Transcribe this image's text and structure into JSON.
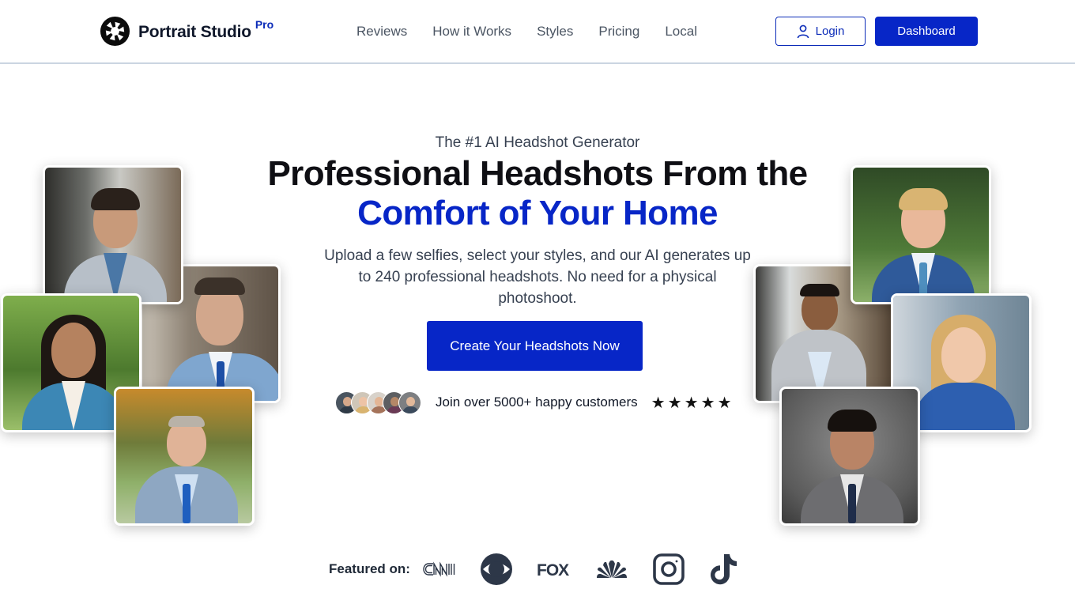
{
  "header": {
    "brand": "Portrait Studio",
    "brand_badge": "Pro",
    "nav": [
      {
        "label": "Reviews"
      },
      {
        "label": "How it Works"
      },
      {
        "label": "Styles"
      },
      {
        "label": "Pricing"
      },
      {
        "label": "Local"
      }
    ],
    "login_label": "Login",
    "dashboard_label": "Dashboard"
  },
  "hero": {
    "eyebrow": "The #1 AI Headshot Generator",
    "headline_line1": "Professional Headshots From the",
    "headline_line2": "Comfort of Your Home",
    "subtext": "Upload a few selfies, select your styles, and our AI generates up to 240 professional headshots. No need for a physical photoshoot.",
    "cta_label": "Create Your Headshots Now",
    "social_proof": "Join over 5000+ happy customers",
    "rating_stars": 5,
    "star_glyph": "★"
  },
  "featured": {
    "label": "Featured on:",
    "logos": [
      "cnn-logo",
      "cbs-logo",
      "fox-logo",
      "nbc-logo",
      "instagram-logo",
      "tiktok-logo"
    ],
    "fox_text": "FOX",
    "cnn_text": "CNN"
  },
  "colors": {
    "brand_blue": "#0726c7",
    "text_dark": "#0f0f14",
    "nav_grey": "#4b5563",
    "media_logo": "#2d3748"
  },
  "photos": [
    {
      "name": "headshot-man-office",
      "side": "left"
    },
    {
      "name": "headshot-man-blue-suit",
      "side": "left"
    },
    {
      "name": "headshot-woman-park",
      "side": "left"
    },
    {
      "name": "headshot-man-glasses",
      "side": "left"
    },
    {
      "name": "headshot-man-blond",
      "side": "right"
    },
    {
      "name": "headshot-man-grey-suit",
      "side": "right"
    },
    {
      "name": "headshot-woman-blonde",
      "side": "right"
    },
    {
      "name": "headshot-man-dark-bg",
      "side": "right"
    }
  ]
}
